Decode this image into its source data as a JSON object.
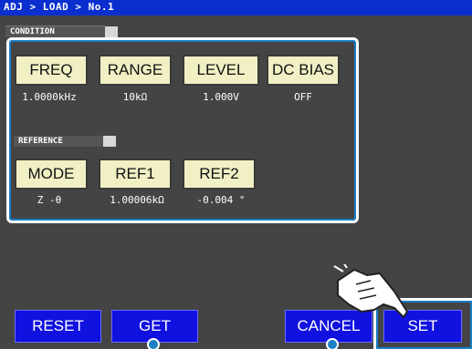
{
  "breadcrumb": "ADJ > LOAD > No.1",
  "condition": {
    "label": "CONDITION",
    "buttons": [
      {
        "label": "FREQ",
        "value": "1.0000kHz"
      },
      {
        "label": "RANGE",
        "value": "10kΩ"
      },
      {
        "label": "LEVEL",
        "value": "1.000V"
      },
      {
        "label": "DC BIAS",
        "value": "OFF"
      }
    ]
  },
  "reference": {
    "label": "REFERENCE",
    "buttons": [
      {
        "label": "MODE",
        "value": "Z -θ"
      },
      {
        "label": "REF1",
        "value": "1.00006kΩ"
      },
      {
        "label": "REF2",
        "value": "-0.004 °"
      }
    ]
  },
  "footer": {
    "reset": "RESET",
    "get": "GET",
    "cancel": "CANCEL",
    "set": "SET"
  },
  "colors": {
    "title_bar": "#0b2fcf",
    "highlight": "#1a7fc4",
    "button_face": "#f1efc4",
    "footer_button": "#1111e0"
  },
  "icons": {
    "pointer": "hand-pointer-icon",
    "callout": "callout-dot-icon"
  }
}
